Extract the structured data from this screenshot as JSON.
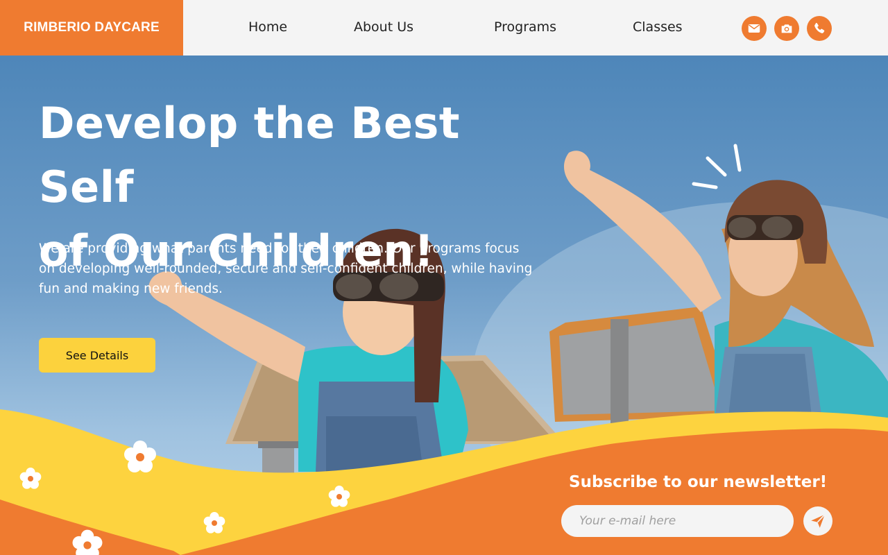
{
  "brand": {
    "name": "RIMBERIO DAYCARE"
  },
  "nav": {
    "items": [
      {
        "label": "Home"
      },
      {
        "label": "About Us"
      },
      {
        "label": "Programs"
      },
      {
        "label": "Classes"
      }
    ]
  },
  "header_icons": [
    "mail-icon",
    "camera-icon",
    "phone-icon"
  ],
  "hero": {
    "headline_line1": "Develop the Best Self",
    "headline_line2": "of Our Children!",
    "description": "We are providing what parents need for their children. Our programs focus on developing well-rounded, secure and self-confident children, while having fun and making new friends.",
    "cta_label": "See Details"
  },
  "newsletter": {
    "title": "Subscribe to our newsletter!",
    "placeholder": "Your e-mail here",
    "submit_icon": "send-icon"
  },
  "colors": {
    "accent_orange": "#ef7b30",
    "accent_yellow": "#fcd23d",
    "sky_blue": "#4e86b9",
    "background": "#f4f4f4"
  }
}
